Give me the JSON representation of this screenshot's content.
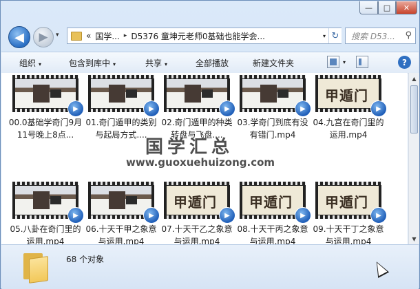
{
  "window": {
    "controls": {
      "minimize": "—",
      "maximize": "□",
      "close": "✕"
    }
  },
  "nav": {
    "back_icon": "◀",
    "forward_icon": "▶",
    "recent_icon": "▾",
    "address": [
      "«",
      "国学...",
      "D5376 童坤元老师0基础也能学会..."
    ],
    "address_seps": [
      "▸"
    ],
    "address_drop": "▾",
    "refresh_icon": "↻",
    "search_placeholder": "搜索 D53...",
    "search_icon": "⚲"
  },
  "toolbar": {
    "organize": "组织",
    "include_library": "包含到库中",
    "share": "共享",
    "play_all": "全部播放",
    "new_folder": "新建文件夹",
    "dropdown_arrow": "▾",
    "help": "?"
  },
  "files": [
    {
      "name": "00.0基础学奇门9月11号晚上8点...",
      "thumb": "room"
    },
    {
      "name": "01.奇门遁甲的类别与起局方式....",
      "thumb": "room"
    },
    {
      "name": "02.奇门遁甲的种类转盘与飞盘....",
      "thumb": "room"
    },
    {
      "name": "03.学奇门到底有没有错门.mp4",
      "thumb": "room"
    },
    {
      "name": "04.九宫在奇门里的运用.mp4",
      "thumb": "callig"
    },
    {
      "name": "05.八卦在奇门里的运用.mp4",
      "thumb": "room"
    },
    {
      "name": "06.十天干甲之象意与运用.mp4",
      "thumb": "room"
    },
    {
      "name": "07.十天干乙之象意与运用.mp4",
      "thumb": "callig"
    },
    {
      "name": "08.十天干丙之象意与运用.mp4",
      "thumb": "callig"
    },
    {
      "name": "09.十天干丁之象意与运用.mp4",
      "thumb": "callig"
    }
  ],
  "thumb_caption": "甲遁门",
  "badge_icon": "▶",
  "watermark": {
    "title": "国学汇总",
    "url": "www.guoxuehuizong.com"
  },
  "scrollbar": {
    "up": "▲",
    "down": "▼"
  },
  "status": {
    "count": "68 个对象"
  }
}
